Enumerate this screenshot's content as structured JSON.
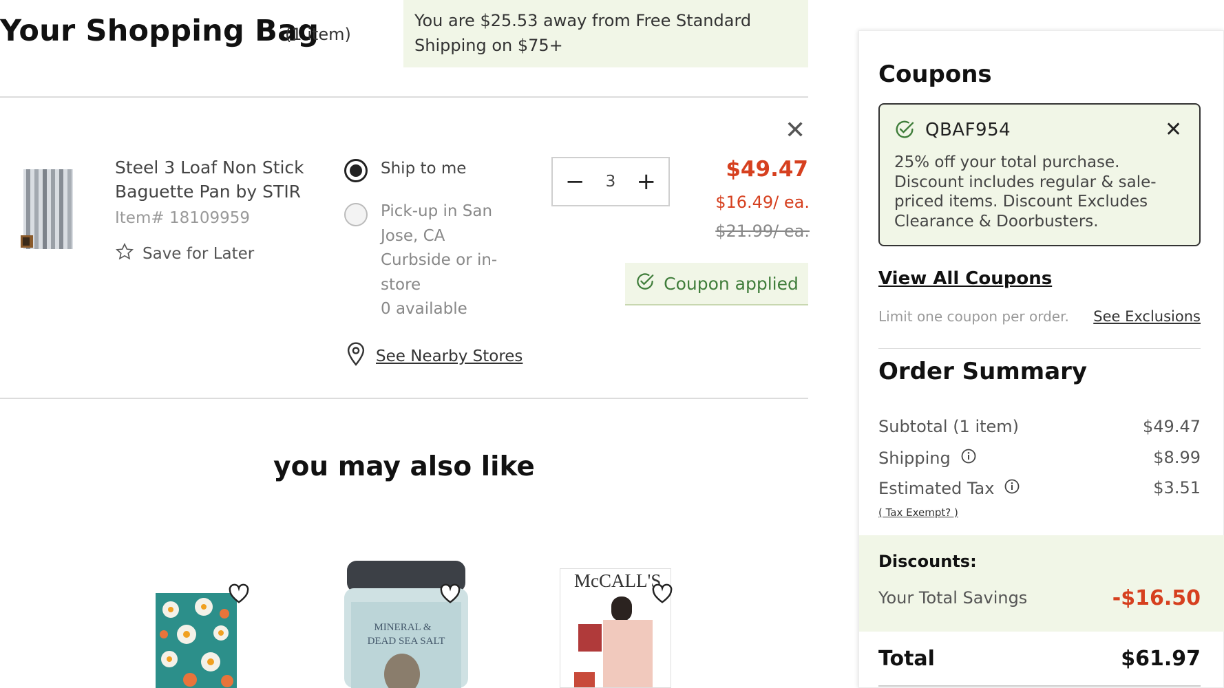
{
  "header": {
    "title": "Your Shopping Bag",
    "item_count": "(1  item)",
    "free_shipping_line1": "You are $25.53 away from Free Standard",
    "free_shipping_line2": "Shipping on $75+"
  },
  "cart_item": {
    "name": "Steel 3 Loaf Non Stick Baguette Pan by STIR",
    "item_number": "Item# 18109959",
    "save_for_later": "Save for Later",
    "ship_option": "Ship to me",
    "pickup_line1": "Pick-up in San",
    "pickup_line2": "Jose, CA",
    "pickup_line3": "Curbside or in-",
    "pickup_line4": "store",
    "pickup_line5": "0 available",
    "nearby_stores": "See Nearby Stores",
    "quantity": "3",
    "price_total": "$49.47",
    "price_each": "$16.49/ ea.",
    "price_was": "$21.99/ ea.",
    "coupon_applied": "Coupon applied",
    "ship_selected": true
  },
  "recommendations": {
    "title": "you may also like",
    "mccalls_label": "McCALL'S",
    "salt_label_1": "MINERAL &",
    "salt_label_2": "DEAD SEA SALT"
  },
  "coupons": {
    "title": "Coupons",
    "code": "QBAF954",
    "description": "25% off your total purchase. Discount includes regular & sale-priced items. Discount Excludes Clearance & Doorbusters.",
    "view_all": "View All Coupons",
    "limit_text": "Limit one coupon per order.",
    "see_exclusions": "See Exclusions"
  },
  "order_summary": {
    "title": "Order Summary",
    "subtotal_label": "Subtotal (1 item)",
    "subtotal_value": "$49.47",
    "shipping_label": "Shipping",
    "shipping_value": "$8.99",
    "tax_label": "Estimated Tax",
    "tax_value": "$3.51",
    "tax_exempt": "( Tax Exempt? )",
    "discounts_title": "Discounts:",
    "savings_label": "Your Total Savings",
    "savings_value": "-$16.50",
    "total_label": "Total",
    "total_value": "$61.97"
  },
  "colors": {
    "accent_red": "#d6401f",
    "success_green": "#3f7d3a",
    "highlight_bg": "#f1f6e7"
  }
}
